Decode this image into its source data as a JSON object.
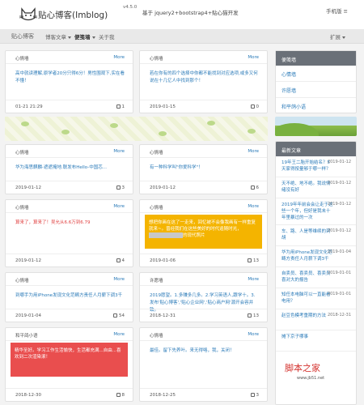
{
  "header": {
    "logo_text": "贴心博客(Imblog)",
    "version": "v4.5.0",
    "tagline": "基于 jquery2+bootstrap4+贴心猫开发",
    "right_link": "手机版 ≡"
  },
  "nav": {
    "brand": "贴心博客",
    "items": [
      {
        "label": "博客文章",
        "dropdown": true
      },
      {
        "label": "便笺墙",
        "dropdown": true,
        "active": true
      },
      {
        "label": "关于我",
        "dropdown": false
      }
    ],
    "right": "扩展"
  },
  "more_label": "More",
  "cards": [
    {
      "author": "心情墙",
      "text": "高中就读理解,原学者20分只得6分！男性围观下,实在看不懂！",
      "date": "01-21 21:29",
      "likes": "1",
      "style": "plain"
    },
    {
      "author": "心情墙",
      "text": "若在你有的四个选择中你都不能找到对应选项,或多又何说在十几亿人中找到那个！",
      "date": "2019-01-15",
      "likes": "0",
      "style": "plain"
    },
    {
      "author": "心情墙",
      "text": "华为海思麒麟-遮遮掩地.联发布Hello-中国芯...",
      "date": "2019-01-12",
      "likes": "3",
      "style": "plain"
    },
    {
      "author": "心情墙",
      "text": "有一种科学叫\"你爱科学\"！",
      "date": "2019-01-12",
      "likes": "6",
      "style": "plain"
    },
    {
      "author": "心情墙",
      "text": "算来了，算来了！吴允从6.6万到6.79",
      "date": "2019-01-12",
      "likes": "4",
      "style": "red"
    },
    {
      "author": "心情墙",
      "text": "想把你画在这了一走来，回忆被不会像我画有一样重复就来~。曾经我们在这些美好的时代追随时光，",
      "text2": "的现代照片",
      "date": "2019-01-06",
      "likes": "13",
      "style": "yellow"
    },
    {
      "author": "心情墙",
      "text": "到哪手为用iPhone发现文化范畴方责任人月薪下调3千",
      "date": "2019-01-04",
      "likes": "54",
      "style": "plain"
    },
    {
      "author": "许愿墙",
      "text": "2019愿望。1.多赚多几多。2.学习英语人,跟学十。3.发布'贴心博客','贴心企业网','贴心商户网'源开会容并致。",
      "date": "2018-12-31",
      "likes": "13",
      "style": "plain"
    },
    {
      "author": "和平鸽小语",
      "text": "精华至好。学习工作生活愉快，生活都充满...自由...喜欢到二次渲染滚！",
      "date": "2018-12-30",
      "likes": "8",
      "style": "redbox"
    },
    {
      "author": "心情墙",
      "text": "最佳。留下先养叶。来无得咯，我，关闭！",
      "date": "2018-12-25",
      "likes": "3",
      "style": "plain"
    }
  ],
  "sidebar": {
    "menu_title": "便笺墙",
    "menu_items": [
      "心情墙",
      "许愿墙",
      "和平鸽小语"
    ],
    "latest_title": "最新文章",
    "news": [
      {
        "title": "19年王二胎开始结名？5天家得按量够于哪一样？",
        "date": "2019-01-12"
      },
      {
        "title": "天不绝、地不绝。我说情绪没有好",
        "date": "2019-01-12"
      },
      {
        "title": "2019年年前会会让走于这些一个年，但好是我未十年里暴过的一次",
        "date": "2019-01-12"
      },
      {
        "title": "车、路、人是等维续的到胡",
        "date": "2019-01-12"
      },
      {
        "title": "华为用iPhone发现文化范畴方责任人月薪下调3千",
        "date": "2019-01-04"
      },
      {
        "title": "自卖员、喜卖员、喜卖员喜对大的报告",
        "date": "2019-01-01"
      },
      {
        "title": "知任本电脑可以一直能看电用？",
        "date": "2019-01-01"
      },
      {
        "title": "赵豆色模考重期的方法",
        "date": "2018-12-31"
      },
      {
        "title": "摊下京子哪事",
        "date": ""
      }
    ]
  },
  "watermark": {
    "main": "脚本之家",
    "sub": "www.jb51.net"
  }
}
